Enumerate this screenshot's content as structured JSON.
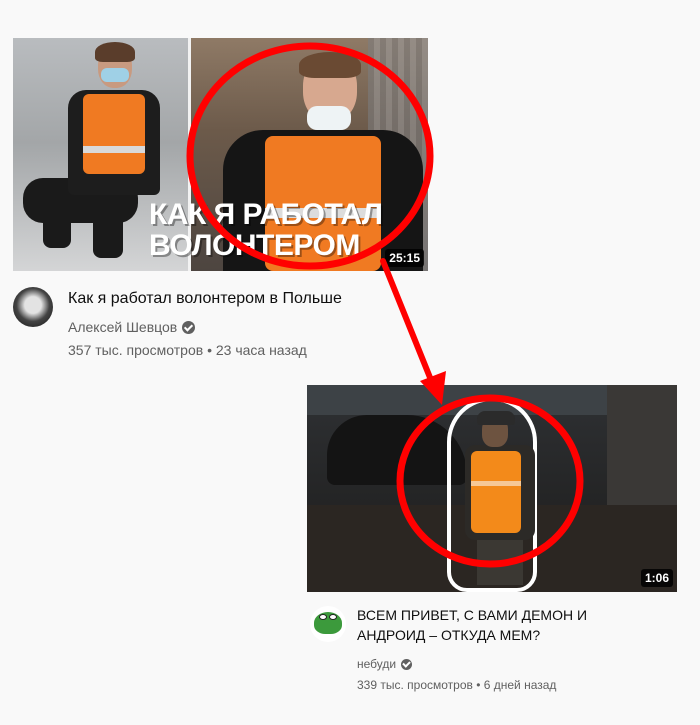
{
  "video1": {
    "thumbnail_overlay_line1": "КАК Я РАБОТАЛ",
    "thumbnail_overlay_line2": "ВОЛОНТЕРОМ",
    "duration": "25:15",
    "title": "Как я работал волонтером в Польше",
    "channel": "Алексей Шевцов",
    "meta": "357 тыс. просмотров • 23 часа назад"
  },
  "video2": {
    "duration": "1:06",
    "title": "ВСЕМ ПРИВЕТ, С ВАМИ ДЕМОН И АНДРОИД – ОТКУДА МЕМ?",
    "channel": "небуди",
    "meta": "339 тыс. просмотров • 6 дней назад"
  },
  "annotation": {
    "circle_color": "#ff0000",
    "arrow_color": "#ff0000"
  },
  "icons": {
    "verified": "verified-check-icon"
  }
}
